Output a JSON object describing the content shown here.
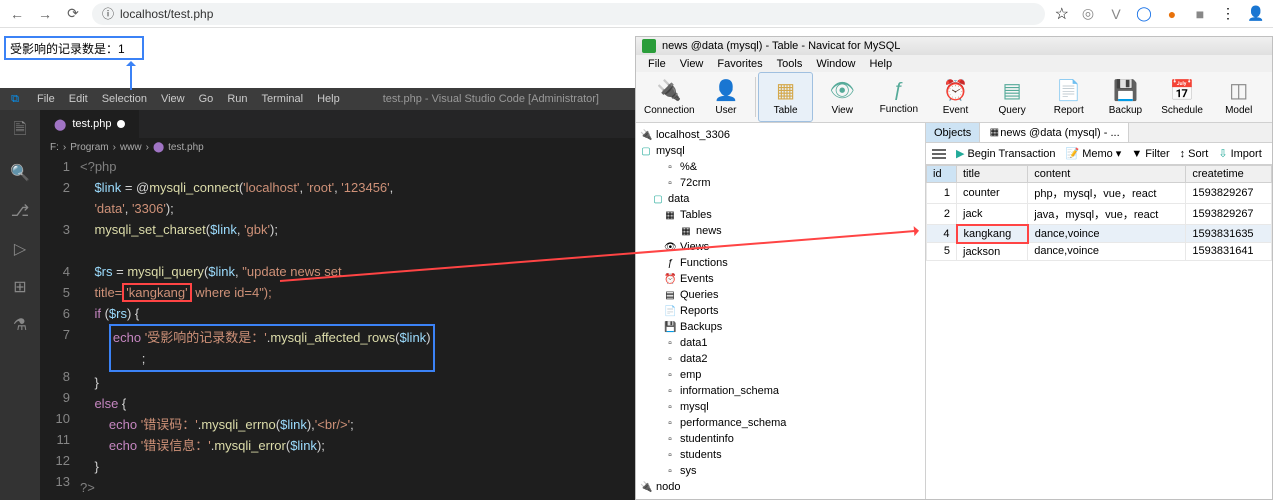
{
  "browser": {
    "url": "localhost/test.php",
    "output_text": "受影响的记录数是：1"
  },
  "vscode": {
    "title": "test.php - Visual Studio Code [Administrator]",
    "menu": [
      "File",
      "Edit",
      "Selection",
      "View",
      "Go",
      "Run",
      "Terminal",
      "Help"
    ],
    "tab": "test.php",
    "breadcrumb": [
      "F:",
      "Program",
      "www",
      "test.php"
    ],
    "code": {
      "l1": "<?php",
      "l2_a": "$link = @mysqli_connect(",
      "l2_s1": "'localhost'",
      "l2_s2": "'root'",
      "l2_s3": "'123456'",
      "l3_s1": "'data'",
      "l3_s2": "'3306'",
      "l4_a": "mysqli_set_charset(",
      "l4_v": "$link",
      "l4_s": "'gbk'",
      "l5_a": "$rs = mysqli_query(",
      "l5_v": "$link",
      "l5_s": "\"update news set",
      "l5b_a": "title=",
      "l5b_hl": "'kangkang'",
      "l5b_b": " where id=4\");",
      "l6": "if ($rs) {",
      "l7_a": "echo ",
      "l7_s": "'受影响的记录数是：'",
      "l7_b": ".mysqli_affected_rows(",
      "l7_v": "$link",
      "l7_c": ")",
      "l7b": ";",
      "l8": "}",
      "l9": "else {",
      "l10_a": "echo ",
      "l10_s": "'错误码：'",
      "l10_b": ".mysqli_errno(",
      "l10_v": "$link",
      "l10_c": "),",
      "l10_s2": "'<br/>'",
      "l10_d": ";",
      "l11_a": "echo ",
      "l11_s": "'错误信息：'",
      "l11_b": ".mysqli_error(",
      "l11_v": "$link",
      "l11_c": ");",
      "l12": "}",
      "l13": "?>"
    }
  },
  "navicat": {
    "title": "news @data (mysql) - Table - Navicat for MySQL",
    "menu": [
      "File",
      "View",
      "Favorites",
      "Tools",
      "Window",
      "Help"
    ],
    "toolbar": [
      "Connection",
      "User",
      "Table",
      "View",
      "Function",
      "Event",
      "Query",
      "Report",
      "Backup",
      "Schedule",
      "Model"
    ],
    "tree": {
      "conn": "localhost_3306",
      "db_mysql": "mysql",
      "items_mysql": [
        "%&",
        "72crm"
      ],
      "db_data": "data",
      "data_items": [
        "Tables",
        "news",
        "Views",
        "Functions",
        "Events",
        "Queries",
        "Reports",
        "Backups"
      ],
      "dbs": [
        "data1",
        "data2",
        "emp",
        "information_schema",
        "mysql",
        "performance_schema",
        "studentinfo",
        "students",
        "sys"
      ],
      "conn2": "nodo"
    },
    "tabs": {
      "objects": "Objects",
      "table": "news @data (mysql) - ..."
    },
    "table_toolbar": {
      "begin": "Begin Transaction",
      "memo": "Memo",
      "filter": "Filter",
      "sort": "Sort",
      "import": "Import"
    },
    "columns": [
      "id",
      "title",
      "content",
      "createtime"
    ],
    "rows": [
      {
        "id": "1",
        "title": "counter",
        "content": "php，mysql，vue，react",
        "createtime": "1593829267"
      },
      {
        "id": "2",
        "title": "jack",
        "content": "java，mysql，vue，react",
        "createtime": "1593829267"
      },
      {
        "id": "4",
        "title": "kangkang",
        "content": "dance,voince",
        "createtime": "1593831635"
      },
      {
        "id": "5",
        "title": "jackson",
        "content": "dance,voince",
        "createtime": "1593831641"
      }
    ]
  }
}
